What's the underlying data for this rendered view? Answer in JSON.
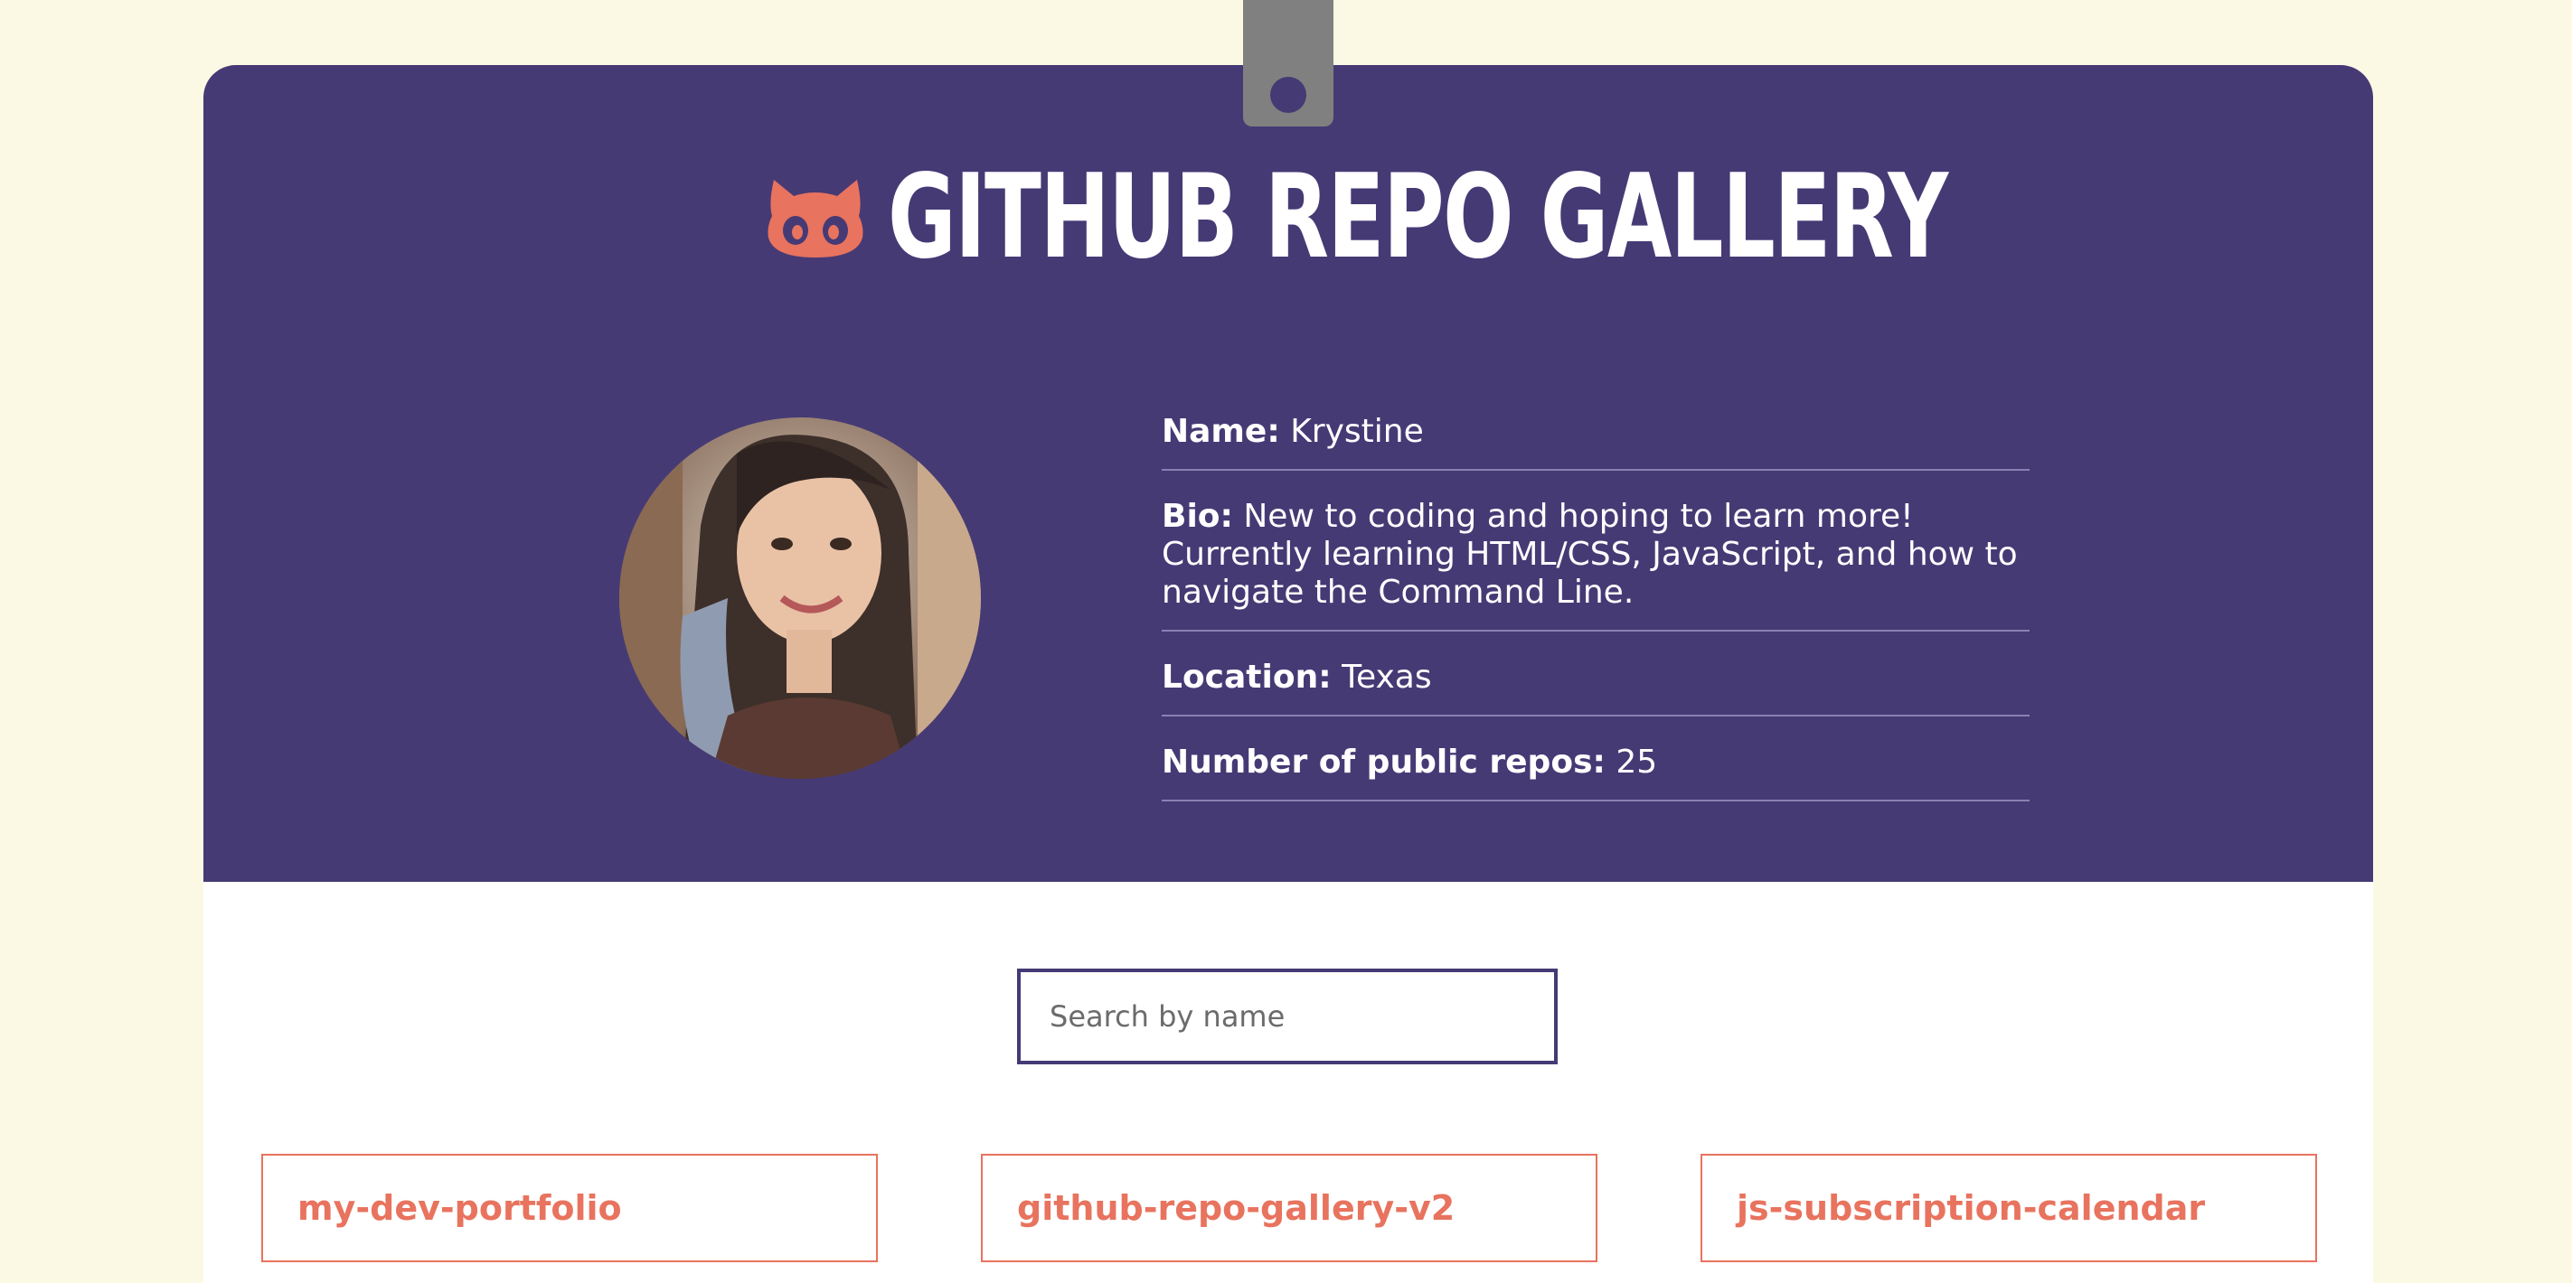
{
  "header": {
    "title": "GITHUB REPO GALLERY",
    "logo_icon": "github-octocat-icon",
    "colors": {
      "header_bg": "#463a75",
      "accent": "#e8735e",
      "page_bg": "#fbf9e3"
    }
  },
  "profile": {
    "avatar_alt": "profile photo",
    "name_label": "Name:",
    "name_value": "Krystine",
    "bio_label": "Bio:",
    "bio_value": "New to coding and hoping to learn more! Currently learning HTML/CSS, JavaScript, and how to navigate the Command Line.",
    "location_label": "Location:",
    "location_value": "Texas",
    "repos_label": "Number of public repos:",
    "repos_value": "25"
  },
  "search": {
    "placeholder": "Search by name"
  },
  "repos": [
    {
      "name": "my-dev-portfolio"
    },
    {
      "name": "github-repo-gallery-v2"
    },
    {
      "name": "js-subscription-calendar"
    }
  ]
}
